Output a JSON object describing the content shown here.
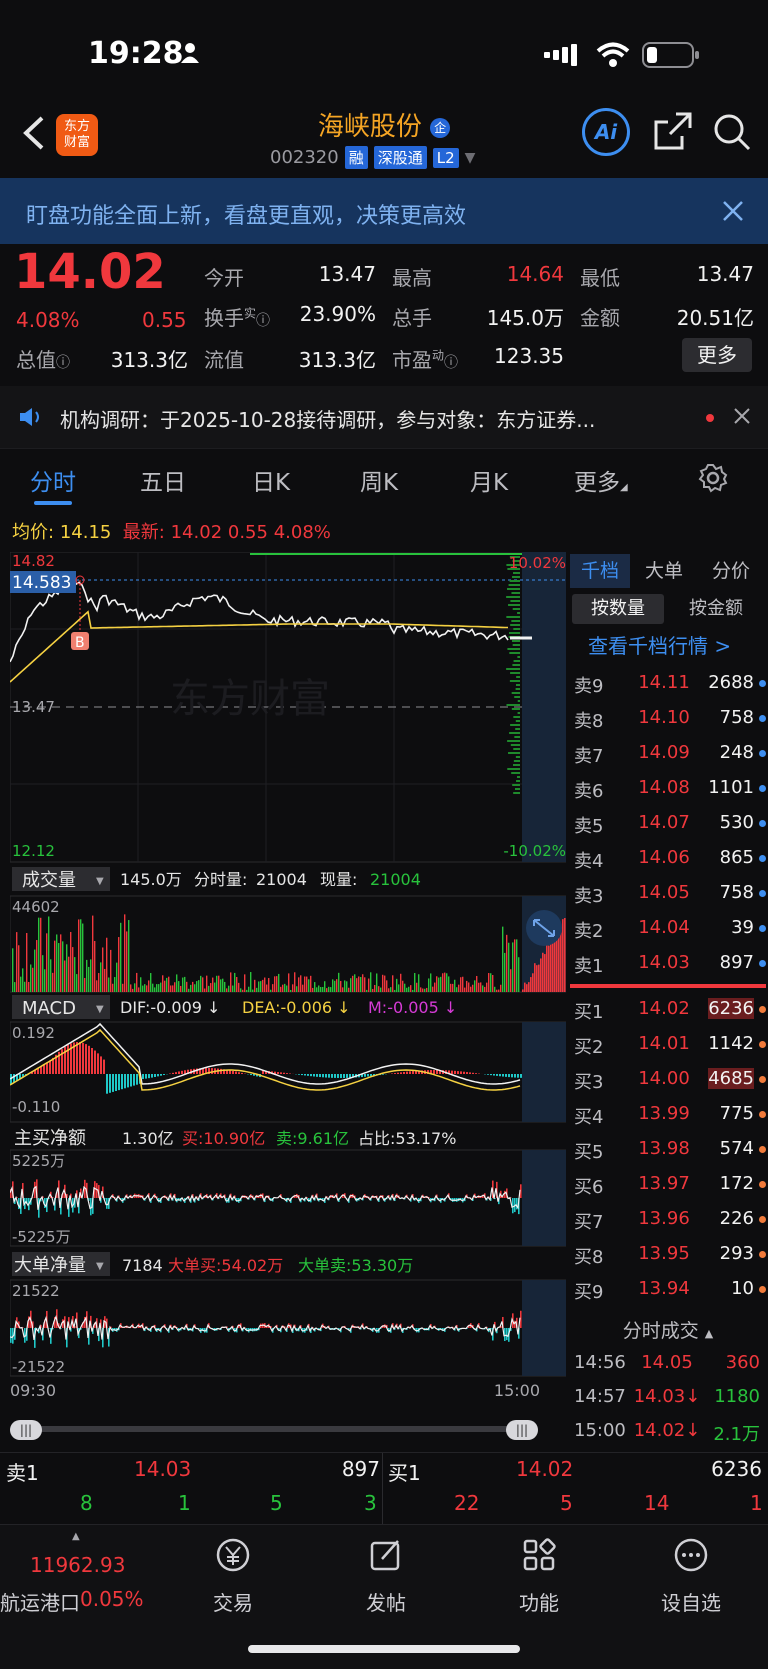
{
  "status_bar": {
    "time": "19:28"
  },
  "header": {
    "logo_text": "东方\n财富",
    "stock_name": "海峡股份",
    "stock_code": "002320",
    "tags": [
      "融",
      "深股通",
      "L2"
    ]
  },
  "banner": {
    "text": "盯盘功能全面上新，看盘更直观，决策更高效"
  },
  "quote": {
    "price": "14.02",
    "change_pct": "4.08%",
    "change": "0.55",
    "fields": [
      {
        "label": "今开",
        "value": "13.47"
      },
      {
        "label": "最高",
        "value": "14.64"
      },
      {
        "label": "最低",
        "value": "13.47"
      },
      {
        "label": "换手",
        "value": "23.90%"
      },
      {
        "label": "总手",
        "value": "145.0万"
      },
      {
        "label": "金额",
        "value": "20.51亿"
      },
      {
        "label": "总值",
        "value": "313.3亿"
      },
      {
        "label": "流值",
        "value": "313.3亿"
      },
      {
        "label": "市盈",
        "value": "123.35"
      }
    ],
    "turnover_sup": "实",
    "pe_sup": "动",
    "more_button": "更多"
  },
  "news": {
    "text": "机构调研：于2025-10-28接待调研，参与对象：东方证券..."
  },
  "tabs": [
    "分时",
    "五日",
    "日K",
    "周K",
    "月K",
    "更多"
  ],
  "intraday": {
    "avg_label": "均价:",
    "avg_value": "14.15",
    "latest_label": "最新:",
    "latest_value": "14.02",
    "latest_change": "0.55",
    "latest_pct": "4.08%",
    "y_top": "14.82",
    "y_cursor": "14.583",
    "y_mid": "13.47",
    "y_bottom": "12.12",
    "pct_top": "10.02%",
    "pct_bottom": "-10.02%",
    "watermark": "东方财富",
    "marker": "B"
  },
  "volume": {
    "label": "成交量",
    "total": "145.0万",
    "min_vol_label": "分时量:",
    "min_vol": "21004",
    "cur_label": "现量:",
    "cur_vol": "21004",
    "y_max": "44602"
  },
  "macd": {
    "label": "MACD",
    "dif": "DIF:-0.009 ↓",
    "dea": "DEA:-0.006 ↓",
    "m": "M:-0.005 ↓",
    "y_max": "0.192",
    "y_min": "-0.110"
  },
  "main_net": {
    "label": "主买净额",
    "value": "1.30亿",
    "buy": "买:10.90亿",
    "sell": "卖:9.61亿",
    "ratio": "占比:53.17%",
    "y_max": "5225万",
    "y_min": "-5225万"
  },
  "big_net": {
    "label": "大单净量",
    "value": "7184",
    "buy": "大单买:54.02万",
    "sell": "大单卖:53.30万",
    "y_max": "21522",
    "y_min": "-21522"
  },
  "time_axis": {
    "start": "09:30",
    "end": "15:00"
  },
  "right_panel": {
    "tabs": [
      "千档",
      "大单",
      "分价"
    ],
    "sub_tabs": [
      "按数量",
      "按金额"
    ],
    "link": "查看千档行情 >",
    "asks": [
      {
        "label": "卖9",
        "price": "14.11",
        "vol": "2688"
      },
      {
        "label": "卖8",
        "price": "14.10",
        "vol": "758"
      },
      {
        "label": "卖7",
        "price": "14.09",
        "vol": "248"
      },
      {
        "label": "卖6",
        "price": "14.08",
        "vol": "1101"
      },
      {
        "label": "卖5",
        "price": "14.07",
        "vol": "530"
      },
      {
        "label": "卖4",
        "price": "14.06",
        "vol": "865"
      },
      {
        "label": "卖3",
        "price": "14.05",
        "vol": "758"
      },
      {
        "label": "卖2",
        "price": "14.04",
        "vol": "39"
      },
      {
        "label": "卖1",
        "price": "14.03",
        "vol": "897"
      }
    ],
    "bids": [
      {
        "label": "买1",
        "price": "14.02",
        "vol": "6236"
      },
      {
        "label": "买2",
        "price": "14.01",
        "vol": "1142"
      },
      {
        "label": "买3",
        "price": "14.00",
        "vol": "4685"
      },
      {
        "label": "买4",
        "price": "13.99",
        "vol": "775"
      },
      {
        "label": "买5",
        "price": "13.98",
        "vol": "574"
      },
      {
        "label": "买6",
        "price": "13.97",
        "vol": "172"
      },
      {
        "label": "买7",
        "price": "13.96",
        "vol": "226"
      },
      {
        "label": "买8",
        "price": "13.95",
        "vol": "293"
      },
      {
        "label": "买9",
        "price": "13.94",
        "vol": "10"
      }
    ],
    "ticks_title": "分时成交",
    "ticks": [
      {
        "time": "14:56",
        "price": "14.05",
        "vol": "360"
      },
      {
        "time": "14:57",
        "price": "14.03↓",
        "vol": "1180"
      },
      {
        "time": "15:00",
        "price": "14.02↓",
        "vol": "2.1万"
      }
    ]
  },
  "bid_bar": {
    "sell_label": "卖1",
    "sell_price": "14.03",
    "sell_vol": "897",
    "buy_label": "买1",
    "buy_price": "14.02",
    "buy_vol": "6236",
    "sell_counts": [
      "8",
      "1",
      "5",
      "3"
    ],
    "buy_counts": [
      "22",
      "5",
      "14",
      "1"
    ]
  },
  "bottom_nav": {
    "index_value": "11962.93",
    "index_name": "航运港口",
    "index_pct": "0.05%",
    "items": [
      "交易",
      "发帖",
      "功能",
      "设自选"
    ]
  },
  "colors": {
    "up": "#f0383d",
    "down": "#28c23c",
    "accent": "#3d8ef0",
    "avg_line": "#f5d142",
    "brand": "#f5a524"
  }
}
